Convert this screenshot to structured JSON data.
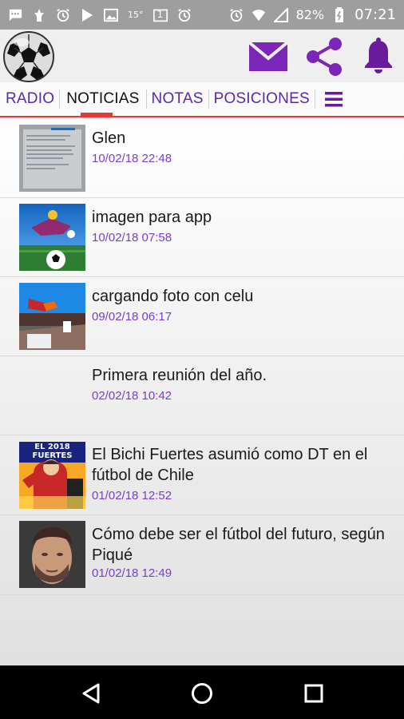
{
  "status_bar": {
    "temperature": "15°",
    "calendar_day": "1",
    "battery": "82%",
    "time": "07:21",
    "icons": [
      "message-icon",
      "notification-icon",
      "alarm-icon",
      "play-icon",
      "image-icon",
      "calendar-icon",
      "alarm-icon",
      "alarm-icon",
      "wifi-icon",
      "signal-icon",
      "battery-icon"
    ]
  },
  "app_bar": {
    "logo_icon": "soccer-ball-icon",
    "actions": [
      "mail-icon",
      "share-icon",
      "bell-icon"
    ],
    "accent_color": "#7b26b8"
  },
  "tabs": {
    "items": [
      {
        "label": "RADIO"
      },
      {
        "label": "NOTICIAS",
        "active": true
      },
      {
        "label": "NOTAS"
      },
      {
        "label": "POSICIONES"
      }
    ],
    "menu_icon": "menu-icon",
    "indicator_color": "#e53935"
  },
  "news": [
    {
      "title": "Glen",
      "date": "10/02/18 22:48",
      "thumbnail": "document-photo"
    },
    {
      "title": "imagen para app",
      "date": "10/02/18 07:58",
      "thumbnail": "soccer-ball-field"
    },
    {
      "title": "cargando foto con celu",
      "date": "09/02/18 06:17",
      "thumbnail": "stadium-photo"
    },
    {
      "title": "Primera reunión del año.",
      "date": "02/02/18 10:42",
      "thumbnail": ""
    },
    {
      "title": "El Bichi Fuertes asumió como DT en el fútbol de Chile",
      "date": "01/02/18 12:52",
      "thumbnail": "el-2018",
      "thumbnail_text": "EL 2018 FUERTES"
    },
    {
      "title": "Cómo debe ser el fútbol del futuro, según Piqué",
      "date": "01/02/18 12:49",
      "thumbnail": "player-portrait"
    }
  ],
  "nav_bar": {
    "buttons": [
      "back-icon",
      "home-icon",
      "recents-icon"
    ]
  }
}
